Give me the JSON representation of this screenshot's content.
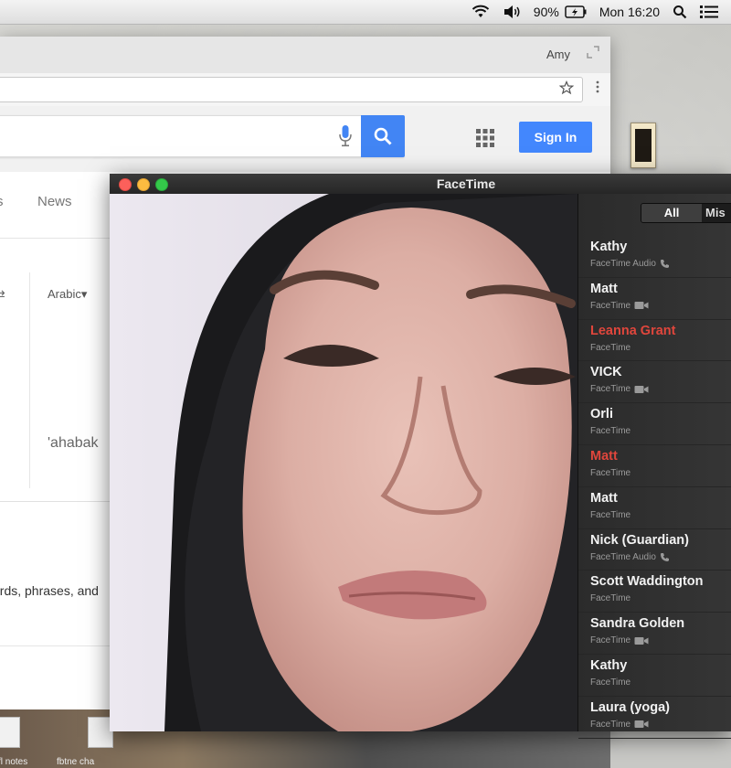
{
  "menubar": {
    "battery": "90%",
    "clock": "Mon 16:20",
    "icons": [
      "wifi-icon",
      "volume-icon",
      "battery-icon",
      "search-icon",
      "notification-list-icon"
    ]
  },
  "browser": {
    "user": "Amy",
    "signin_label": "Sign In",
    "tab_partial": "s",
    "tab_news": "News",
    "swap_glyph": "⇄",
    "target_language": "Arabic▾",
    "translation_text": "'ahabak",
    "description_fragment": "ords, phrases, and"
  },
  "files": [
    {
      "label": ""
    },
    {
      "label": "fl notes"
    },
    {
      "label": "fbtne cha"
    }
  ],
  "facetime": {
    "title": "FaceTime",
    "segment_all": "All",
    "segment_missed": "Mis",
    "contacts": [
      {
        "name": "Kathy",
        "type": "FaceTime Audio",
        "icon": "phone-icon",
        "missed": false
      },
      {
        "name": "Matt",
        "type": "FaceTime",
        "icon": "video-camera-icon",
        "missed": false
      },
      {
        "name": "Leanna Grant",
        "type": "FaceTime",
        "icon": "",
        "missed": true
      },
      {
        "name": "VICK",
        "type": "FaceTime",
        "icon": "video-camera-icon",
        "missed": false
      },
      {
        "name": "Orli",
        "type": "FaceTime",
        "icon": "",
        "missed": false
      },
      {
        "name": "Matt",
        "type": "FaceTime",
        "icon": "",
        "missed": true
      },
      {
        "name": "Matt",
        "type": "FaceTime",
        "icon": "",
        "missed": false
      },
      {
        "name": "Nick (Guardian)",
        "type": "FaceTime Audio",
        "icon": "phone-icon",
        "missed": false
      },
      {
        "name": "Scott Waddington",
        "type": "FaceTime",
        "icon": "",
        "missed": false
      },
      {
        "name": "Sandra Golden",
        "type": "FaceTime",
        "icon": "video-camera-icon",
        "missed": false
      },
      {
        "name": "Kathy",
        "type": "FaceTime",
        "icon": "",
        "missed": false
      },
      {
        "name": "Laura (yoga)",
        "type": "FaceTime",
        "icon": "video-camera-icon",
        "missed": false
      }
    ]
  },
  "colors": {
    "missed": "#e0463c",
    "google_blue": "#4285f4"
  }
}
